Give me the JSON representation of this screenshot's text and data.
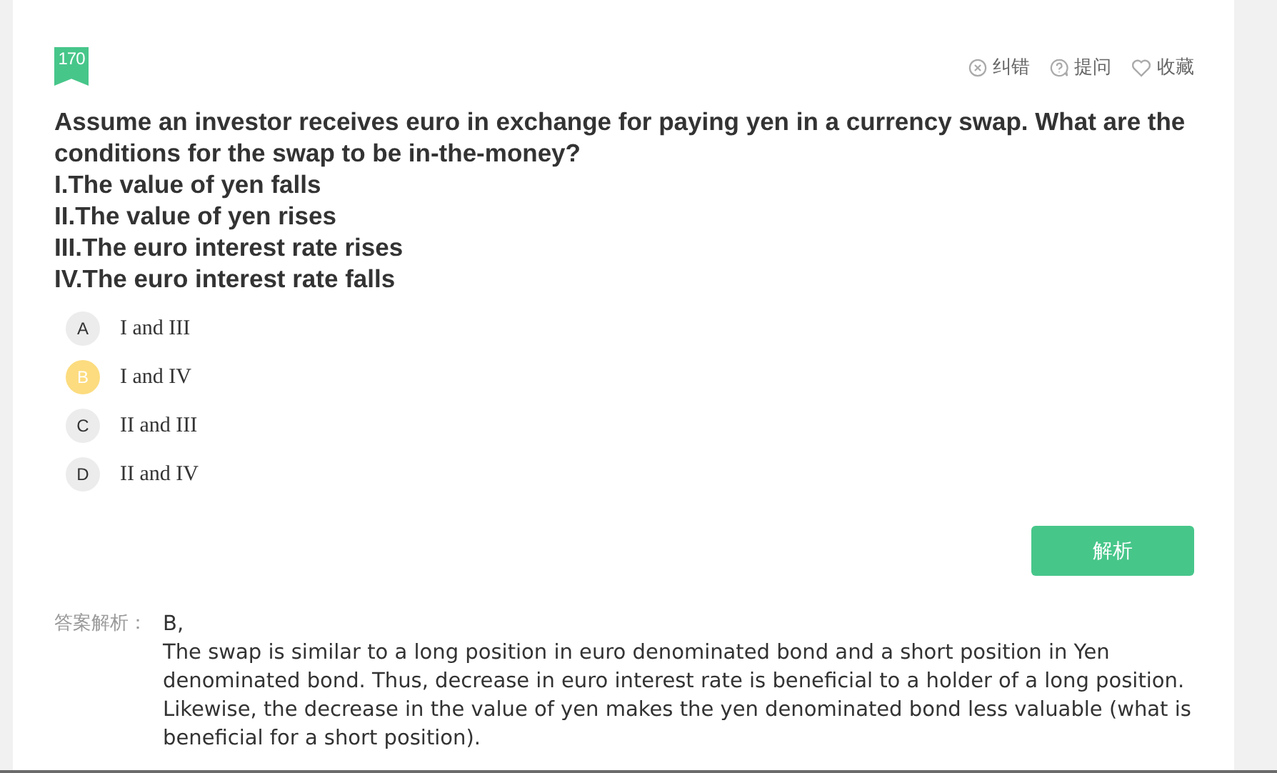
{
  "question_number": "170",
  "actions": [
    {
      "kind": "error",
      "label": "纠错"
    },
    {
      "kind": "ask",
      "label": "提问"
    },
    {
      "kind": "favorite",
      "label": "收藏"
    }
  ],
  "question": "Assume an investor receives euro in exchange for paying yen in a currency swap. What are the conditions for the swap to be in-the-money?",
  "statements": [
    "I.The value of yen falls",
    "II.The value of yen rises",
    "III.The euro interest rate rises",
    "IV.The euro interest rate falls"
  ],
  "options": [
    {
      "letter": "A",
      "text": "I and III",
      "selected": false
    },
    {
      "letter": "B",
      "text": "I and IV",
      "selected": true
    },
    {
      "letter": "C",
      "text": "II and III",
      "selected": false
    },
    {
      "letter": "D",
      "text": "II and IV",
      "selected": false
    }
  ],
  "analysis_button": "解析",
  "analysis_label": "答案解析：",
  "answer": "B,",
  "explanation": "The swap is similar to a long position in euro denominated bond and a short position in Yen denominated bond. Thus, decrease in euro interest rate is beneficial to a holder of a long position. Likewise, the decrease in the value of yen makes the yen denominated bond less valuable (what is beneficial for a short position)."
}
